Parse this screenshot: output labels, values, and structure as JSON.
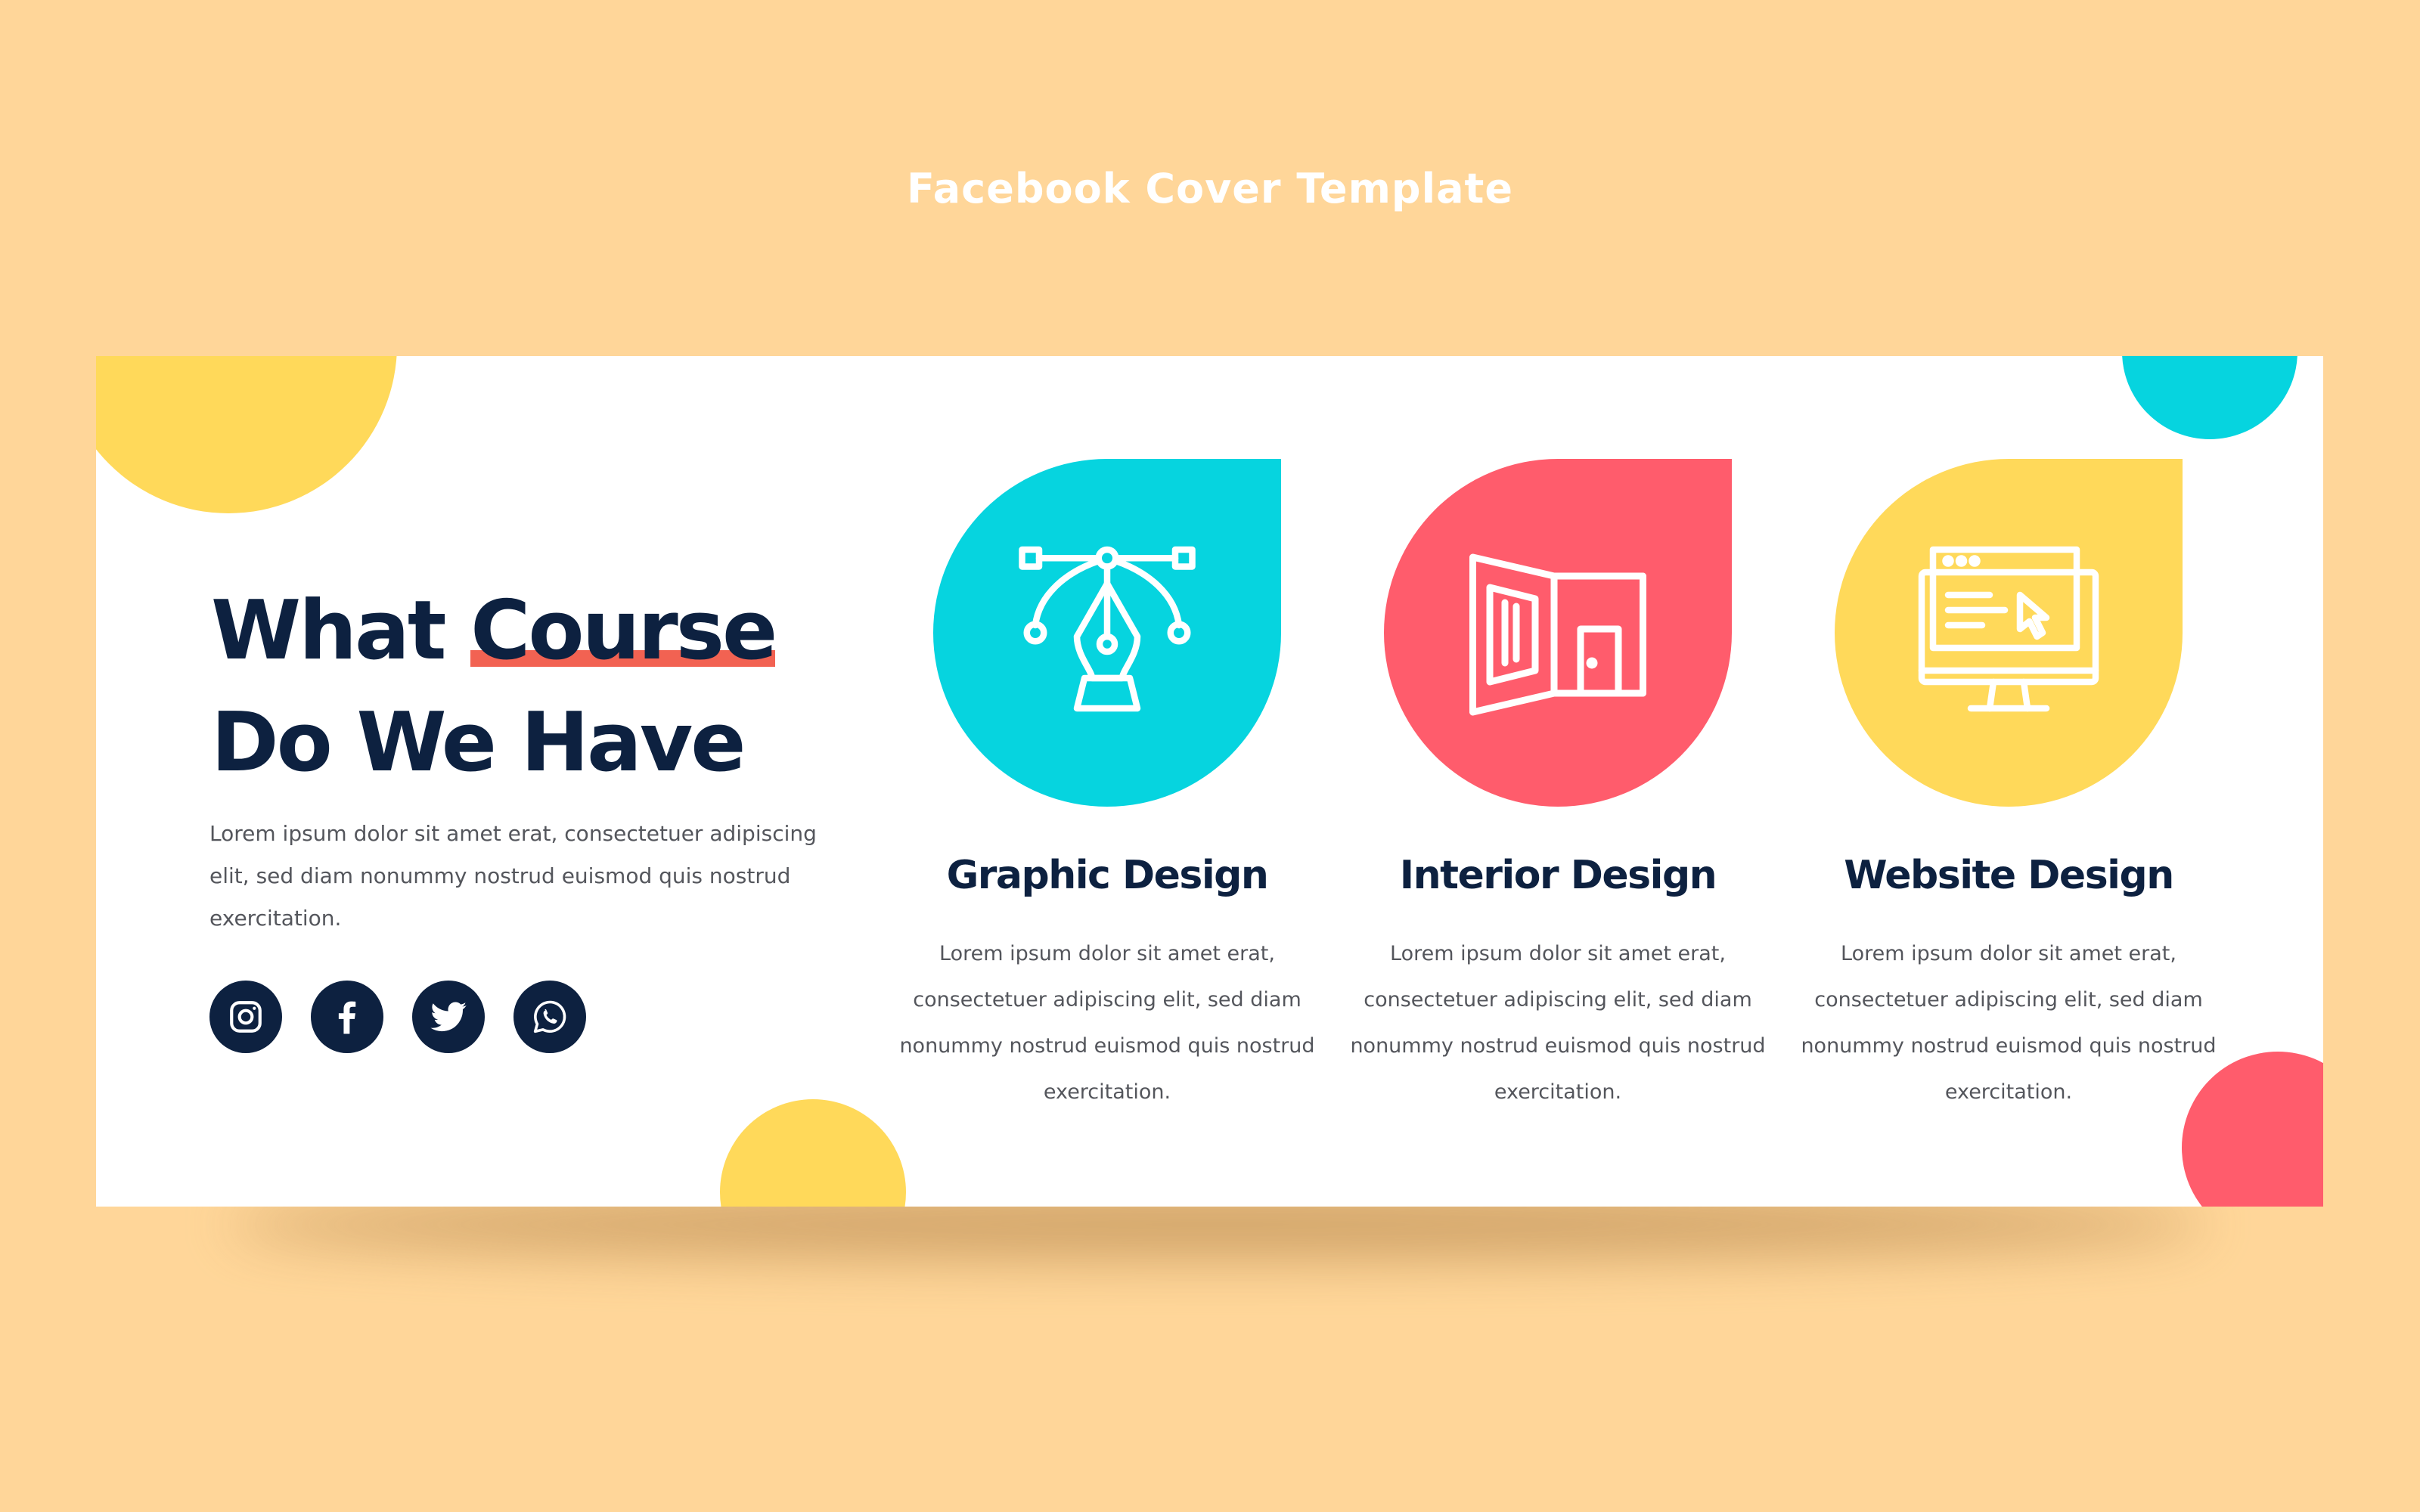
{
  "page": {
    "caption": "Facebook Cover Template",
    "background_color": "#FFD699"
  },
  "cover": {
    "headline_line1_start": "What ",
    "headline_highlight": "Course",
    "headline_line2": "Do We Have",
    "intro": "Lorem ipsum dolor sit amet erat, consectetuer adipiscing elit, sed diam nonummy nostrud euismod quis nostrud exercitation.",
    "colors": {
      "navy": "#0D2140",
      "cyan": "#06D4DF",
      "red": "#FF5C6C",
      "yellow": "#FFD95A",
      "underline": "#F26252"
    },
    "socials": [
      {
        "icon": "instagram-icon"
      },
      {
        "icon": "facebook-icon"
      },
      {
        "icon": "twitter-icon"
      },
      {
        "icon": "whatsapp-icon"
      }
    ],
    "courses": [
      {
        "title": "Graphic Design",
        "icon": "pen-tool-icon",
        "color": "#06D4DF",
        "description": "Lorem ipsum dolor sit amet erat, consectetuer adipiscing elit, sed diam nonummy nostrud euismod quis nostrud exercitation."
      },
      {
        "title": "Interior Design",
        "icon": "open-door-icon",
        "color": "#FF5C6C",
        "description": "Lorem ipsum dolor sit amet erat, consectetuer adipiscing elit, sed diam nonummy nostrud euismod quis nostrud exercitation."
      },
      {
        "title": "Website Design",
        "icon": "monitor-browser-icon",
        "color": "#FFD95A",
        "description": "Lorem ipsum dolor sit amet erat, consectetuer adipiscing elit, sed diam nonummy nostrud euismod quis nostrud exercitation."
      }
    ]
  }
}
